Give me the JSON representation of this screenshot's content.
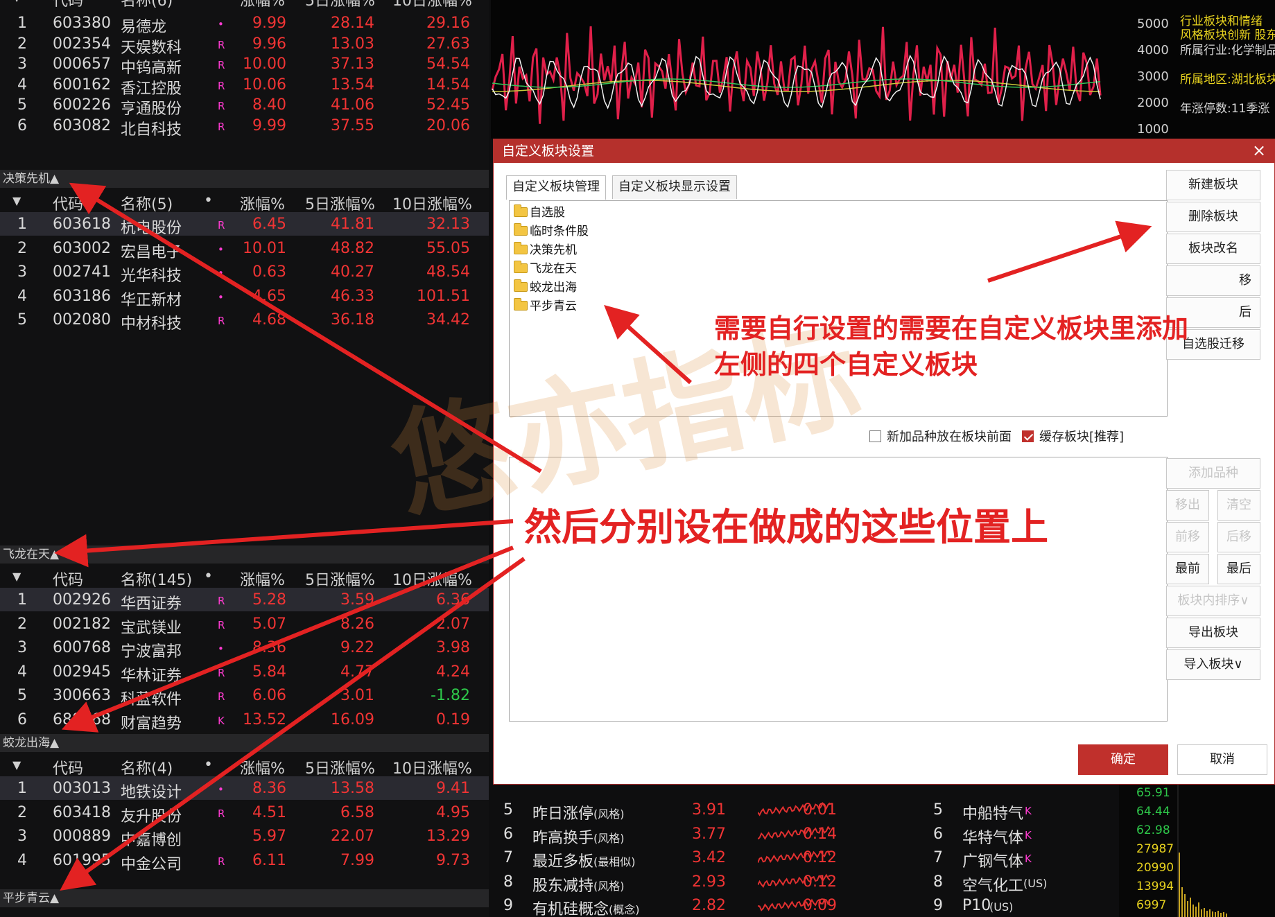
{
  "columns": {
    "code": "代码",
    "pct": "涨幅%",
    "pct5": "5日涨幅%",
    "pct10": "10日涨幅%",
    "dot": "•"
  },
  "top_list": {
    "header_name": "名称(6)",
    "rows": [
      {
        "idx": "1",
        "code": "603380",
        "name": "易德龙",
        "flag": "•",
        "p1": "9.99",
        "p5": "28.14",
        "p10": "29.16"
      },
      {
        "idx": "2",
        "code": "002354",
        "name": "天娱数科",
        "flag": "R",
        "p1": "9.96",
        "p5": "13.03",
        "p10": "27.63"
      },
      {
        "idx": "3",
        "code": "000657",
        "name": "中钨高新",
        "flag": "R",
        "p1": "10.00",
        "p5": "37.13",
        "p10": "54.54"
      },
      {
        "idx": "4",
        "code": "600162",
        "name": "香江控股",
        "flag": "R",
        "p1": "10.06",
        "p5": "13.54",
        "p10": "14.54"
      },
      {
        "idx": "5",
        "code": "600226",
        "name": "亨通股份",
        "flag": "R",
        "p1": "8.40",
        "p5": "41.06",
        "p10": "52.45"
      },
      {
        "idx": "6",
        "code": "603082",
        "name": "北自科技",
        "flag": "R",
        "p1": "9.99",
        "p5": "37.55",
        "p10": "20.06"
      }
    ]
  },
  "sections": [
    {
      "title": "决策先机▲",
      "header_name": "名称(5)",
      "rows": [
        {
          "idx": "1",
          "code": "603618",
          "name": "杭电股份",
          "flag": "R",
          "p1": "6.45",
          "p5": "41.81",
          "p10": "32.13"
        },
        {
          "idx": "2",
          "code": "603002",
          "name": "宏昌电子",
          "flag": "•",
          "p1": "10.01",
          "p5": "48.82",
          "p10": "55.05"
        },
        {
          "idx": "3",
          "code": "002741",
          "name": "光华科技",
          "flag": "•",
          "p1": "0.63",
          "p5": "40.27",
          "p10": "48.54"
        },
        {
          "idx": "4",
          "code": "603186",
          "name": "华正新材",
          "flag": "•",
          "p1": "4.65",
          "p5": "46.33",
          "p10": "101.51"
        },
        {
          "idx": "5",
          "code": "002080",
          "name": "中材科技",
          "flag": "R",
          "p1": "4.68",
          "p5": "36.18",
          "p10": "34.42"
        }
      ]
    },
    {
      "title": "飞龙在天▲",
      "header_name": "名称(145)",
      "rows": [
        {
          "idx": "1",
          "code": "002926",
          "name": "华西证券",
          "flag": "R",
          "p1": "5.28",
          "p5": "3.59",
          "p10": "6.36"
        },
        {
          "idx": "2",
          "code": "002182",
          "name": "宝武镁业",
          "flag": "R",
          "p1": "5.07",
          "p5": "8.26",
          "p10": "2.07"
        },
        {
          "idx": "3",
          "code": "600768",
          "name": "宁波富邦",
          "flag": "•",
          "p1": "8.36",
          "p5": "9.22",
          "p10": "3.98"
        },
        {
          "idx": "4",
          "code": "002945",
          "name": "华林证券",
          "flag": "R",
          "p1": "5.84",
          "p5": "4.77",
          "p10": "4.24"
        },
        {
          "idx": "5",
          "code": "300663",
          "name": "科蓝软件",
          "flag": "R",
          "p1": "6.06",
          "p5": "3.01",
          "p10": "-1.82"
        },
        {
          "idx": "6",
          "code": "688168",
          "name": "财富趋势",
          "flag": "K",
          "p1": "13.52",
          "p5": "16.09",
          "p10": "0.19"
        }
      ]
    },
    {
      "title": "蛟龙出海▲",
      "header_name": "名称(4)",
      "rows": [
        {
          "idx": "1",
          "code": "003013",
          "name": "地铁设计",
          "flag": "•",
          "p1": "8.36",
          "p5": "13.58",
          "p10": "9.41"
        },
        {
          "idx": "2",
          "code": "603418",
          "name": "友升股份",
          "flag": "R",
          "p1": "4.51",
          "p5": "6.58",
          "p10": "4.95"
        },
        {
          "idx": "3",
          "code": "000889",
          "name": "中嘉博创",
          "flag": "",
          "p1": "5.97",
          "p5": "22.07",
          "p10": "13.29"
        },
        {
          "idx": "4",
          "code": "601995",
          "name": "中金公司",
          "flag": "R",
          "p1": "6.11",
          "p5": "7.99",
          "p10": "9.73"
        }
      ]
    }
  ],
  "bottom_section_title": "平步青云▲",
  "top_chart": {
    "y_labels": [
      "5000",
      "4000",
      "3000",
      "2000",
      "1000"
    ],
    "info_lines": [
      "行业板块和情绪",
      "风格板块创新 股东",
      "所属行业:化学制品",
      "所属地区:湖北板块",
      "年涨停数:11季涨"
    ]
  },
  "dialog": {
    "title": "自定义板块设置",
    "close": "×",
    "tabs": [
      "自定义板块管理",
      "自定义板块显示设置"
    ],
    "folders": [
      "自选股",
      "临时条件股",
      "决策先机",
      "飞龙在天",
      "蛟龙出海",
      "平步青云"
    ],
    "buttons_top": [
      "新建板块",
      "删除板块",
      "板块改名",
      "移",
      "后",
      "自选股迁移"
    ],
    "checkbox_front": "新加品种放在板块前面",
    "checkbox_cache": "缓存板块[推荐]",
    "buttons_bottom": {
      "add": "添加品种",
      "remove": "移出",
      "clear": "清空",
      "forward": "前移",
      "back": "后移",
      "first": "最前",
      "last": "最后",
      "sort": "板块内排序∨",
      "export": "导出板块",
      "import": "导入板块∨"
    },
    "ok": "确定",
    "cancel": "取消"
  },
  "annotations": {
    "line1": "需要自行设置的需要在自定义板块里添加",
    "line2": "左侧的四个自定义板块",
    "main": "然后分别设在做成的这些位置上"
  },
  "bottom_right": {
    "rows_left": [
      {
        "idx": "5",
        "name": "昨日涨停",
        "tag": "(风格)",
        "v1": "3.91",
        "v2": "0.01"
      },
      {
        "idx": "6",
        "name": "昨高换手",
        "tag": "(风格)",
        "v1": "3.77",
        "v2": "0.14"
      },
      {
        "idx": "7",
        "name": "最近多板",
        "tag": "(最相似)",
        "v1": "3.42",
        "v2": "0.12"
      },
      {
        "idx": "8",
        "name": "股东减持",
        "tag": "(风格)",
        "v1": "2.93",
        "v2": "0.12"
      },
      {
        "idx": "9",
        "name": "有机硅概念",
        "tag": "(概念)",
        "v1": "2.82",
        "v2": "0.09"
      }
    ],
    "rows_right": [
      {
        "idx": "5",
        "name": "中船特气",
        "flag": "K"
      },
      {
        "idx": "6",
        "name": "华特气体",
        "flag": "K"
      },
      {
        "idx": "7",
        "name": "广钢气体",
        "flag": "K"
      },
      {
        "idx": "8",
        "name": "空气化工",
        "tag": "(US)"
      },
      {
        "idx": "9",
        "name": "P10",
        "tag": "(US)"
      }
    ],
    "far_values": [
      {
        "text": "65.91",
        "color": "#2ec84a"
      },
      {
        "text": "64.44",
        "color": "#2ec84a"
      },
      {
        "text": "62.98",
        "color": "#2ec84a"
      },
      {
        "text": "27987",
        "color": "#e7d21f"
      },
      {
        "text": "20990",
        "color": "#e7d21f"
      },
      {
        "text": "13994",
        "color": "#e7d21f"
      },
      {
        "text": "6997",
        "color": "#e7d21f"
      }
    ]
  }
}
